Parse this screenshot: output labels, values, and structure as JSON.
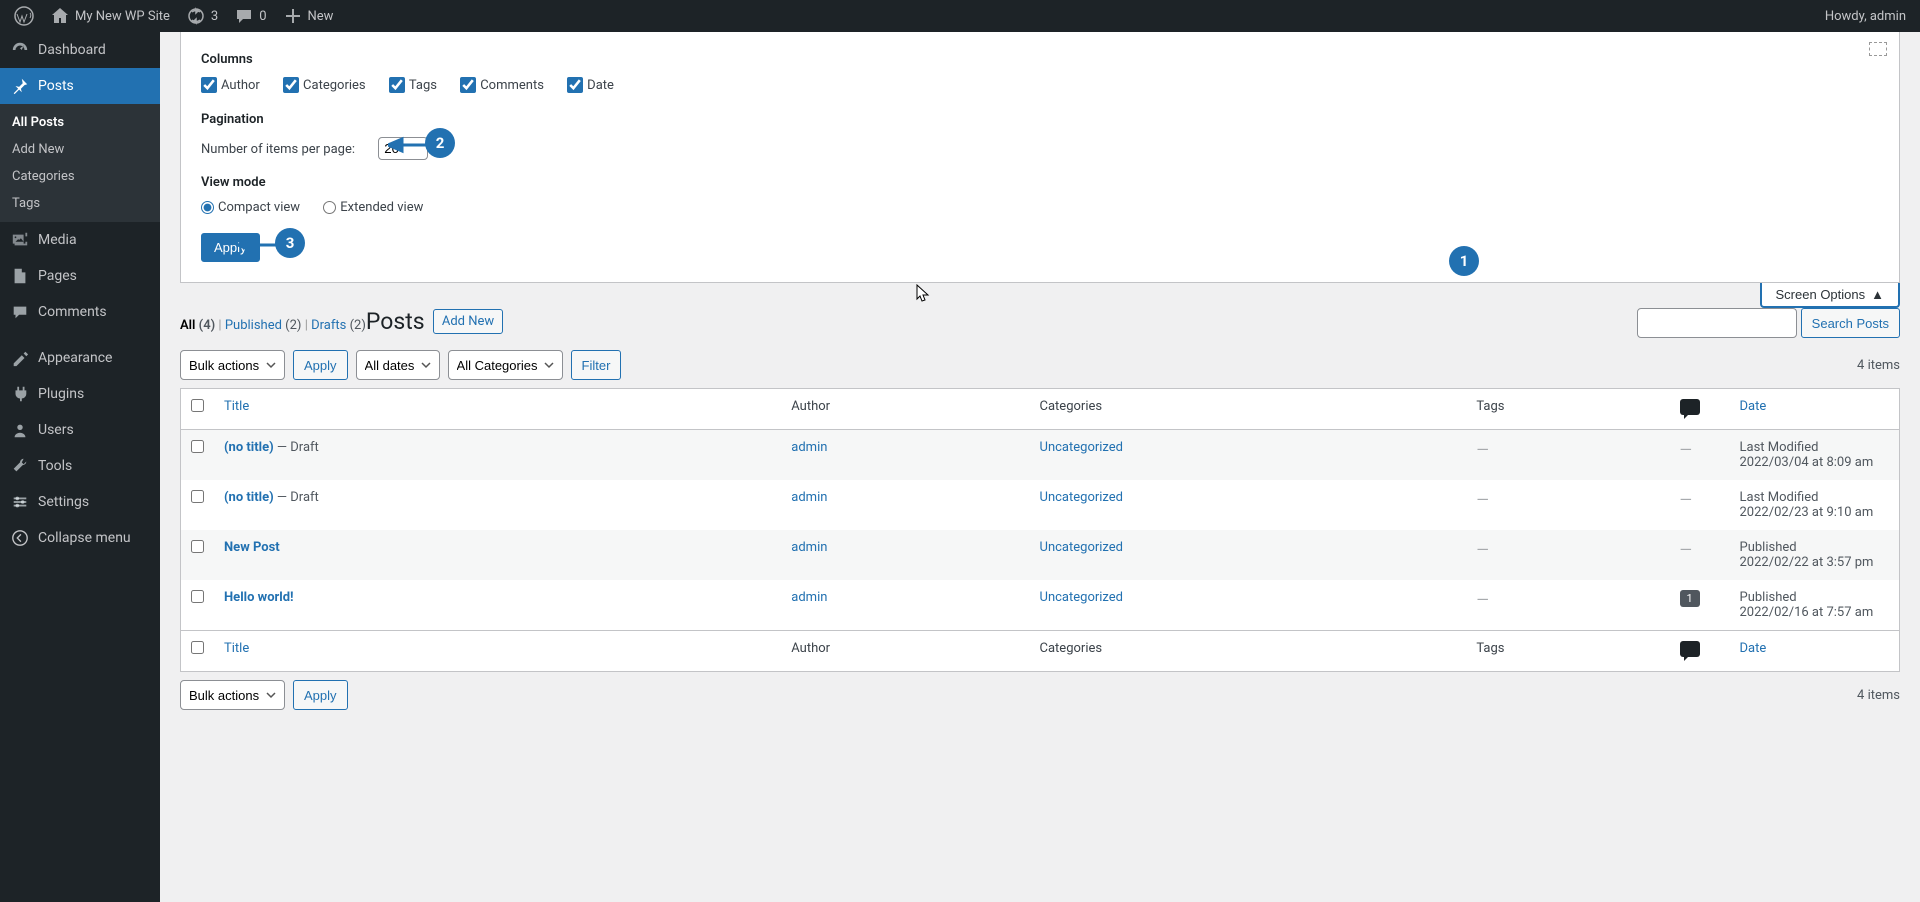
{
  "adminbar": {
    "site_name": "My New WP Site",
    "updates_count": "3",
    "comments_count": "0",
    "new_label": "New",
    "howdy": "Howdy, admin"
  },
  "sidebar": {
    "dashboard": "Dashboard",
    "posts": "Posts",
    "posts_sub": {
      "all": "All Posts",
      "add": "Add New",
      "cats": "Categories",
      "tags": "Tags"
    },
    "media": "Media",
    "pages": "Pages",
    "comments": "Comments",
    "appearance": "Appearance",
    "plugins": "Plugins",
    "users": "Users",
    "tools": "Tools",
    "settings": "Settings",
    "collapse": "Collapse menu"
  },
  "screen_options": {
    "columns_legend": "Columns",
    "col_author": "Author",
    "col_categories": "Categories",
    "col_tags": "Tags",
    "col_comments": "Comments",
    "col_date": "Date",
    "pagination_legend": "Pagination",
    "per_page_label": "Number of items per page:",
    "per_page_value": "20",
    "view_legend": "View mode",
    "compact": "Compact view",
    "extended": "Extended view",
    "apply": "Apply",
    "tab_label": "Screen Options"
  },
  "heading": {
    "title": "Posts",
    "add_new": "Add New"
  },
  "filters": {
    "all_label": "All",
    "all_count": "(4)",
    "published_label": "Published",
    "published_count": "(2)",
    "drafts_label": "Drafts",
    "drafts_count": "(2)"
  },
  "search": {
    "button": "Search Posts"
  },
  "tablenav": {
    "bulk": "Bulk actions",
    "apply": "Apply",
    "dates": "All dates",
    "cats": "All Categories",
    "filter": "Filter",
    "count": "4 items"
  },
  "columns": {
    "title": "Title",
    "author": "Author",
    "categories": "Categories",
    "tags": "Tags",
    "date": "Date"
  },
  "rows": [
    {
      "title": "(no title)",
      "state": " — Draft",
      "author": "admin",
      "categories": "Uncategorized",
      "tags": "—",
      "comments": "—",
      "date_status": "Last Modified",
      "date": "2022/03/04 at 8:09 am"
    },
    {
      "title": "(no title)",
      "state": " — Draft",
      "author": "admin",
      "categories": "Uncategorized",
      "tags": "—",
      "comments": "—",
      "date_status": "Last Modified",
      "date": "2022/02/23 at 9:10 am"
    },
    {
      "title": "New Post",
      "state": "",
      "author": "admin",
      "categories": "Uncategorized",
      "tags": "—",
      "comments": "—",
      "date_status": "Published",
      "date": "2022/02/22 at 3:57 pm"
    },
    {
      "title": "Hello world!",
      "state": "",
      "author": "admin",
      "categories": "Uncategorized",
      "tags": "—",
      "comments": "1",
      "date_status": "Published",
      "date": "2022/02/16 at 7:57 am"
    }
  ],
  "annotations": {
    "n1": "1",
    "n2": "2",
    "n3": "3"
  }
}
